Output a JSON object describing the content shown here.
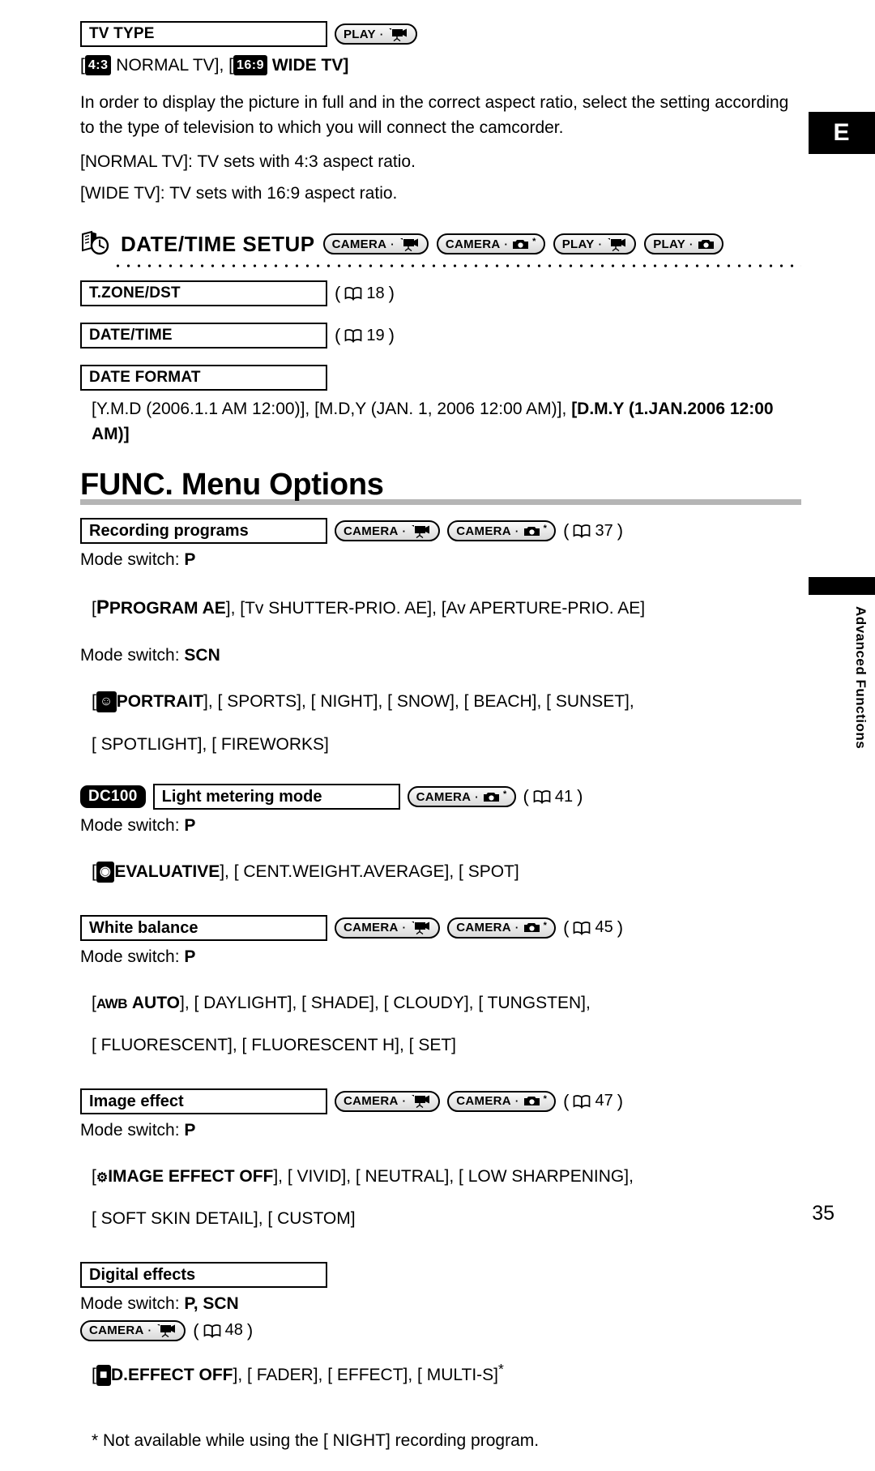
{
  "page": {
    "number": "35",
    "language_tab": "E",
    "side_label": "Advanced Functions"
  },
  "tv_type": {
    "title": "TV TYPE",
    "badge": "PLAY · ▶",
    "options_line": {
      "pre": "[",
      "ratio1": "4:3",
      "opt1": " NORMAL TV], [",
      "ratio2": "16:9",
      "opt2": " WIDE TV]"
    },
    "paragraph": "In order to display the picture in full and in the correct aspect ratio, select the setting according to the type of television to which you will connect the camcorder.",
    "note1": "[NORMAL TV]: TV sets with 4:3 aspect ratio.",
    "note2": "[WIDE TV]: TV sets with 16:9 aspect ratio."
  },
  "date_time_setup": {
    "title": "DATE/TIME SETUP",
    "badges": [
      "CAMERA",
      "CAMERA",
      "PLAY",
      "PLAY"
    ],
    "items": [
      {
        "title": "T.ZONE/DST",
        "page_ref": "18"
      },
      {
        "title": "DATE/TIME",
        "page_ref": "19"
      }
    ],
    "date_format": {
      "title": "DATE FORMAT",
      "options": "[Y.M.D (2006.1.1 AM 12:00)], [M.D,Y (JAN. 1, 2006 12:00 AM)], ",
      "options_bold": "[D.M.Y (1.JAN.2006 12:00 AM)]"
    }
  },
  "func_menu": {
    "heading": "FUNC. Menu Options",
    "sections": [
      {
        "title": "Recording programs",
        "page_ref": "37",
        "mode_switch_label": "Mode switch:",
        "mode_switch_value": "P",
        "options_bold": "PROGRAM AE",
        "options_rest": "], [Tv SHUTTER-PRIO. AE], [Av APERTURE-PRIO. AE]",
        "mode_switch2_label": "Mode switch:",
        "mode_switch2_value": "SCN",
        "scene_line1_bold": "PORTRAIT",
        "scene_line1_rest": "], [ SPORTS], [ NIGHT], [ SNOW], [ BEACH], [ SUNSET],",
        "scene_line2": "[ SPOTLIGHT], [ FIREWORKS]"
      },
      {
        "model_badge": "DC100",
        "title": "Light metering mode",
        "page_ref": "41",
        "mode_switch_label": "Mode switch:",
        "mode_switch_value": "P",
        "options_bold": "EVALUATIVE",
        "options_rest": "], [ CENT.WEIGHT.AVERAGE], [ SPOT]"
      },
      {
        "title": "White balance",
        "page_ref": "45",
        "mode_switch_label": "Mode switch:",
        "mode_switch_value": "P",
        "options_bold": "AUTO",
        "line1_rest": "], [ DAYLIGHT], [ SHADE], [ CLOUDY], [ TUNGSTEN],",
        "line2": "[ FLUORESCENT], [ FLUORESCENT H], [ SET]"
      },
      {
        "title": "Image effect",
        "page_ref": "47",
        "mode_switch_label": "Mode switch:",
        "mode_switch_value": "P",
        "options_bold": "IMAGE EFFECT OFF",
        "line1_rest": "], [ VIVID], [ NEUTRAL], [ LOW SHARPENING],",
        "line2": "[ SOFT SKIN DETAIL], [ CUSTOM]"
      },
      {
        "title": "Digital effects",
        "page_ref": "48",
        "mode_switch_label": "Mode switch:",
        "mode_switch_value": "P, SCN",
        "options_bold": "D.EFFECT OFF",
        "options_rest": "], [ FADER], [ EFFECT], [ MULTI-S]",
        "footnote": "* Not available while using the [ NIGHT] recording program."
      }
    ]
  }
}
